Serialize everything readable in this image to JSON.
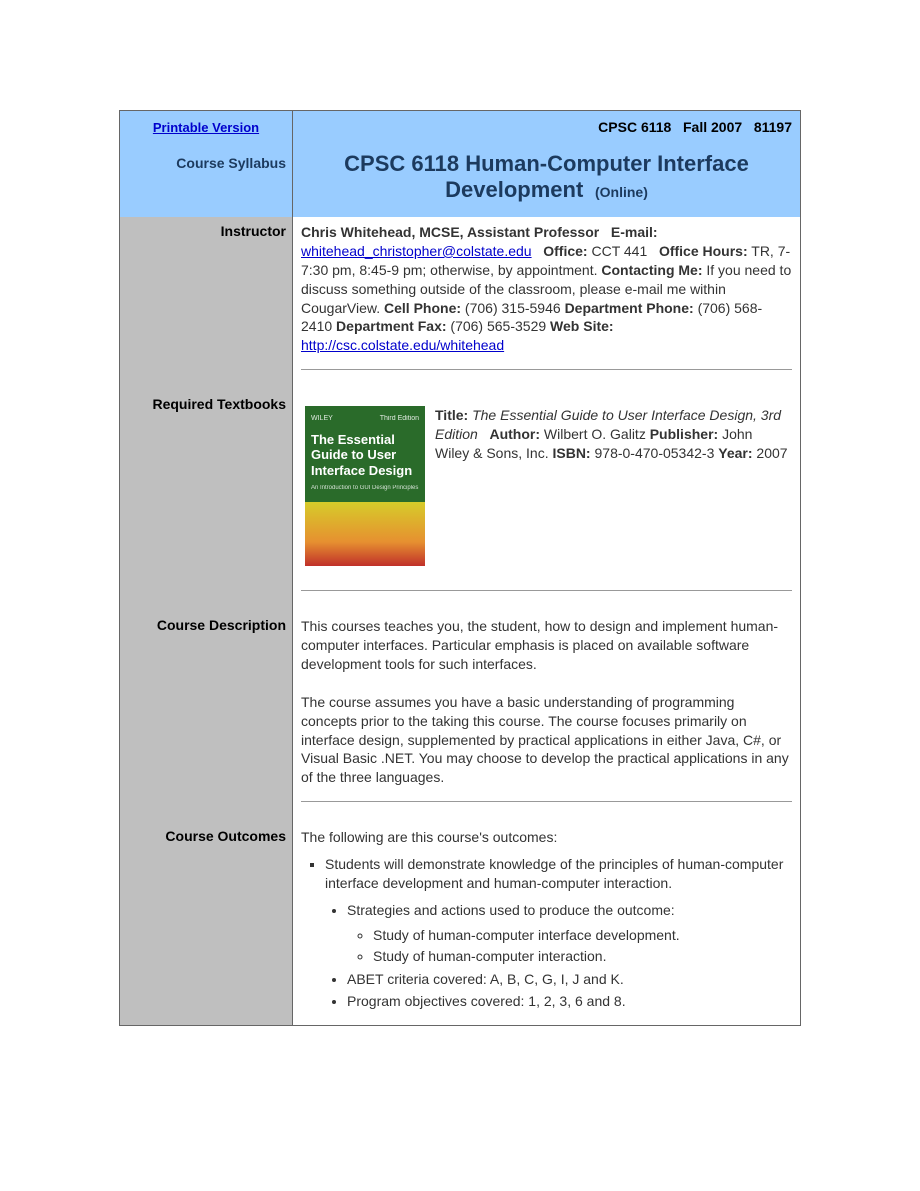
{
  "header": {
    "printable_link": "Printable Version",
    "course_code": "CPSC 6118",
    "term": "Fall 2007",
    "crn": "81197"
  },
  "title": {
    "label": "Course Syllabus",
    "course_title": "CPSC 6118 Human-Computer Interface Development",
    "mode": "(Online)"
  },
  "instructor": {
    "label": "Instructor",
    "name": "Chris Whitehead, MCSE, Assistant Professor",
    "email_label": "E-mail:",
    "email": "whitehead_christopher@colstate.edu",
    "office_label": "Office:",
    "office": "CCT 441",
    "office_hours_label": "Office Hours:",
    "office_hours": " TR, 7-7:30 pm, 8:45-9 pm; otherwise, by appointment.    ",
    "contacting_label": "Contacting Me:",
    "contacting": " If you need to discuss something outside of the classroom, please e-mail me within CougarView.    ",
    "cell_label": "Cell Phone:",
    "cell": " (706) 315-5946   ",
    "dept_phone_label": "Department Phone:",
    "dept_phone": " (706) 568-2410   ",
    "dept_fax_label": "Department Fax:",
    "dept_fax": " (706) 565-3529   ",
    "website_label": "Web Site:",
    "website": "http://csc.colstate.edu/whitehead"
  },
  "textbook": {
    "label": "Required Textbooks",
    "cover": {
      "publisher_small": "WILEY",
      "edition_small": "Third Edition",
      "title_line1": "The Essential Guide to User Interface Design",
      "subtitle": "An Introduction to GUI Design Principles"
    },
    "title_label": "Title:",
    "title": "The Essential Guide to User Interface Design, 3rd Edition",
    "author_label": "Author:",
    "author": " Wilbert O. Galitz   ",
    "publisher_label": "Publisher:",
    "publisher": " John Wiley & Sons, Inc.   ",
    "isbn_label": "ISBN:",
    "isbn": "  978-0-470-05342-3   ",
    "year_label": "Year:",
    "year": " 2007"
  },
  "description": {
    "label": "Course Description",
    "p1": "This courses teaches you, the student, how to design and implement human-computer interfaces. Particular emphasis is placed on available software development tools for such interfaces.",
    "p2": "The course assumes you have a basic understanding of programming concepts prior to the taking this course. The course focuses primarily on interface design, supplemented by practical applications in either Java, C#, or Visual Basic .NET. You may choose to develop the practical applications in any of the three languages."
  },
  "outcomes": {
    "label": "Course Outcomes",
    "intro": "The following are this course's outcomes:",
    "item1": "Students will demonstrate knowledge of the principles of human-computer interface development and human-computer interaction.",
    "sub1": "Strategies and actions used to produce the outcome:",
    "sub1a": "Study of human-computer interface development.",
    "sub1b": "Study of human-computer interaction.",
    "sub2": "ABET criteria covered: A, B, C, G, I, J and K.",
    "sub3": "Program objectives covered: 1, 2, 3, 6 and 8."
  }
}
